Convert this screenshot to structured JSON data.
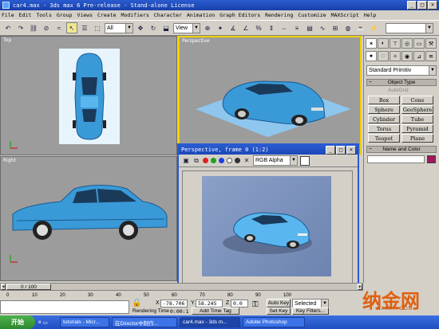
{
  "window": {
    "title": "car4.max - 3ds max 6 Pre-release - Stand-alone License",
    "min": "_",
    "max": "□",
    "close": "×"
  },
  "menu": [
    "File",
    "Edit",
    "Tools",
    "Group",
    "Views",
    "Create",
    "Modifiers",
    "Character",
    "Animation",
    "Graph Editors",
    "Rendering",
    "Customize",
    "MAXScript",
    "Help"
  ],
  "toolbar": {
    "filter_value": "All",
    "refcoord_value": "View",
    "named_sel_value": ""
  },
  "viewports": {
    "top": "Top",
    "perspective": "Perspective",
    "right": "Right"
  },
  "command_panel": {
    "category_value": "Standard Primitiv",
    "object_type_header": "Object Type",
    "autogrid_label": "AutoGrid",
    "objects": [
      "Box",
      "Cone",
      "Sphere",
      "GeoSphere",
      "Cylinder",
      "Tube",
      "Torus",
      "Pyramid",
      "Teapot",
      "Plane"
    ],
    "name_color_header": "Name and Color",
    "object_color": "#a0185a"
  },
  "render_window": {
    "title": "Perspective, frame 0 (1:2)",
    "channel_value": "RGB Alpha",
    "close": "×"
  },
  "timeline": {
    "slider_label": "0 / 100",
    "ticks": [
      "0",
      "10",
      "20",
      "30",
      "40",
      "50",
      "60",
      "70",
      "80",
      "90",
      "100"
    ]
  },
  "status": {
    "x_label": "X",
    "x_value": "-78.706",
    "y_label": "Y",
    "y_value": "58.245",
    "z_label": "Z",
    "z_value": "0.0",
    "rendering_time_label": "Rendering Time",
    "rendering_time_value": "0:00:1",
    "add_time_tag": "Add Time Tag",
    "auto_key": "Auto Key",
    "set_key": "Set Key",
    "selected_value": "Selected",
    "key_filters": "Key Filters..."
  },
  "taskbar": {
    "start": "开始",
    "tasks": [
      "tutorials - Micr...",
      "在Director中制作...",
      "car4.max - 3ds m...",
      "Adobe Photoshop"
    ]
  },
  "watermark": {
    "brand": "纳金网",
    "url": "NARKII.COM"
  },
  "colors": {
    "car_blue": "#3a9ad8",
    "title_blue": "#2a5bd0",
    "viewport_gray": "#9c9c9c",
    "active_border": "#f0d000"
  }
}
